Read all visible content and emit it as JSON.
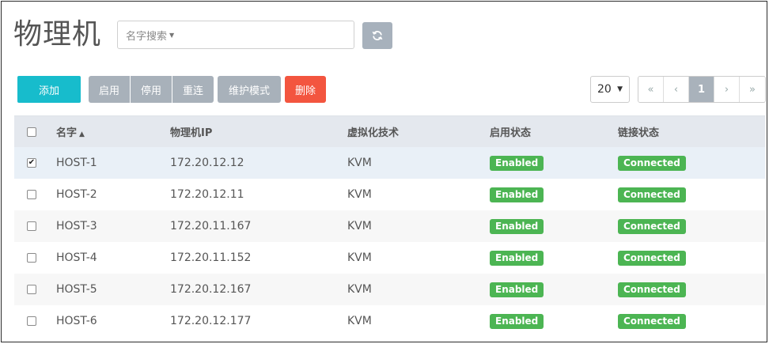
{
  "page": {
    "title": "物理机"
  },
  "search": {
    "placeholder": "名字搜索",
    "icon": "caret-down-icon"
  },
  "toolbar": {
    "add_label": "添加",
    "enable_label": "启用",
    "disable_label": "停用",
    "restart_label": "重连",
    "maintenance_label": "维护模式",
    "delete_label": "删除",
    "colors": {
      "add": "#17bccc",
      "group": "#a8b1ba",
      "delete": "#f3553f"
    }
  },
  "pagination": {
    "page_size": "20",
    "first": "«",
    "prev": "‹",
    "current": "1",
    "next": "›",
    "last": "»"
  },
  "table": {
    "headers": {
      "name": "名字",
      "ip": "物理机IP",
      "virt": "虚拟化技术",
      "enabled": "启用状态",
      "link": "链接状态"
    },
    "sort": {
      "column": "name",
      "direction": "asc",
      "symbol": "▲"
    },
    "rows": [
      {
        "checked": true,
        "name": "HOST-1",
        "ip": "172.20.12.12",
        "virt": "KVM",
        "enabled": "Enabled",
        "link": "Connected"
      },
      {
        "checked": false,
        "name": "HOST-2",
        "ip": "172.20.12.11",
        "virt": "KVM",
        "enabled": "Enabled",
        "link": "Connected"
      },
      {
        "checked": false,
        "name": "HOST-3",
        "ip": "172.20.11.167",
        "virt": "KVM",
        "enabled": "Enabled",
        "link": "Connected"
      },
      {
        "checked": false,
        "name": "HOST-4",
        "ip": "172.20.11.152",
        "virt": "KVM",
        "enabled": "Enabled",
        "link": "Connected"
      },
      {
        "checked": false,
        "name": "HOST-5",
        "ip": "172.20.12.167",
        "virt": "KVM",
        "enabled": "Enabled",
        "link": "Connected"
      },
      {
        "checked": false,
        "name": "HOST-6",
        "ip": "172.20.12.177",
        "virt": "KVM",
        "enabled": "Enabled",
        "link": "Connected"
      }
    ],
    "status_color": "#4cb553"
  }
}
